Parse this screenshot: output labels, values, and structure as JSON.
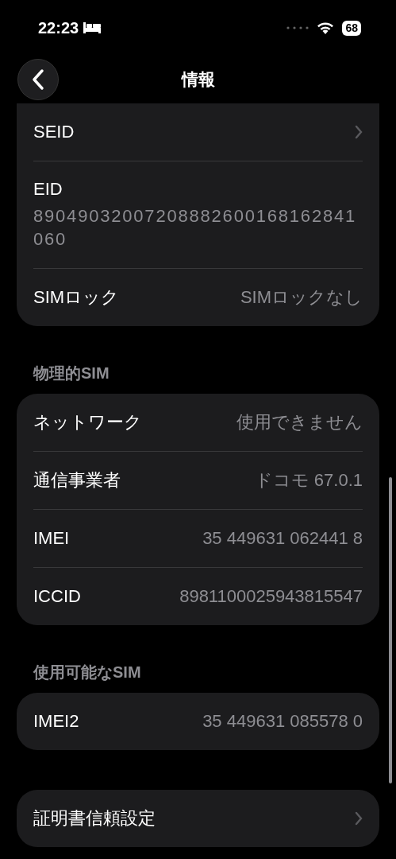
{
  "status_bar": {
    "time": "22:23",
    "battery": "68"
  },
  "nav": {
    "title": "情報"
  },
  "sections": [
    {
      "rows": [
        {
          "kind": "link",
          "label": "SEID"
        },
        {
          "kind": "stacked",
          "label": "EID",
          "value": "89049032007208882600168162841060"
        },
        {
          "kind": "value",
          "label": "SIMロック",
          "value": "SIMロックなし"
        }
      ]
    },
    {
      "header": "物理的SIM",
      "rows": [
        {
          "kind": "value",
          "label": "ネットワーク",
          "value": "使用できません"
        },
        {
          "kind": "value",
          "label": "通信事業者",
          "value": "ドコモ 67.0.1"
        },
        {
          "kind": "value",
          "label": "IMEI",
          "value": "35 449631 062441 8"
        },
        {
          "kind": "value",
          "label": "ICCID",
          "value": "8981100025943815547"
        }
      ]
    },
    {
      "header": "使用可能なSIM",
      "rows": [
        {
          "kind": "value",
          "label": "IMEI2",
          "value": "35 449631 085578 0"
        }
      ]
    },
    {
      "rows": [
        {
          "kind": "link",
          "label": "証明書信頼設定"
        }
      ]
    }
  ]
}
